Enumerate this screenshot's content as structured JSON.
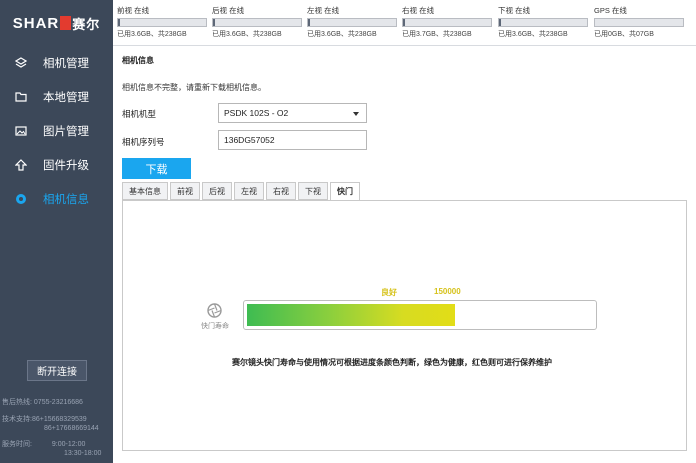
{
  "brand": {
    "logo_text": "SHAR",
    "logo_cn": "赛尔"
  },
  "sidebar": {
    "items": [
      {
        "label": "相机管理",
        "icon": "layers-icon"
      },
      {
        "label": "本地管理",
        "icon": "folder-icon"
      },
      {
        "label": "图片管理",
        "icon": "image-icon"
      },
      {
        "label": "固件升级",
        "icon": "upload-arrow-icon"
      },
      {
        "label": "相机信息",
        "icon": "camera-info-icon"
      }
    ],
    "disconnect_label": "断开连接",
    "contact": {
      "hotline_label": "售后热线:",
      "hotline": "0755-23216686",
      "support_label": "技术支持:",
      "support_1": "86+15668329539",
      "support_2": "86+17668669144",
      "hours_label": "服务时间:",
      "hours_1": "9:00-12:00",
      "hours_2": "13:30-18:00"
    },
    "colors": {
      "background": "#3c4859",
      "active": "#1aa6ef"
    }
  },
  "storage": [
    {
      "head": "前视 在线",
      "used": "已用3.6GB、共238GB",
      "used_fraction": 0.015
    },
    {
      "head": "后视 在线",
      "used": "已用3.6GB、共238GB",
      "used_fraction": 0.015
    },
    {
      "head": "左视 在线",
      "used": "已用3.6GB、共238GB",
      "used_fraction": 0.015
    },
    {
      "head": "右视 在线",
      "used": "已用3.7GB、共238GB",
      "used_fraction": 0.016
    },
    {
      "head": "下视 在线",
      "used": "已用3.6GB、共238GB",
      "used_fraction": 0.015
    },
    {
      "head": "GPS 在线",
      "used": "已用0GB、共07GB",
      "used_fraction": 0.0
    }
  ],
  "main": {
    "title": "相机信息",
    "notice": "相机信息不完整，请重新下载相机信息。",
    "model_label": "相机机型",
    "model_value": "PSDK 102S - O2",
    "serial_label": "相机序列号",
    "serial_value": "136DG57052",
    "download_label": "下载",
    "tabs": [
      "基本信息",
      "前视",
      "后视",
      "左视",
      "右视",
      "下视",
      "快门"
    ],
    "active_tab": "快门",
    "shutter": {
      "icon_label": "快门寿命",
      "status": "良好",
      "count": "150000",
      "fill_fraction": 0.6,
      "description": "赛尔镜头快门寿命与使用情况可根据进度条颜色判断，绿色为健康，红色则可进行保养维护"
    }
  }
}
